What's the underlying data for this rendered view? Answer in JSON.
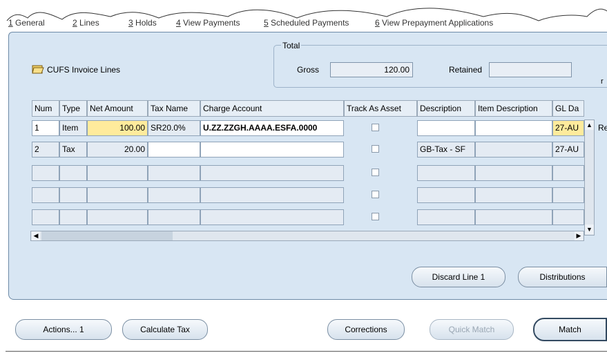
{
  "tabs": [
    {
      "mnemonic": "1",
      "label": " General"
    },
    {
      "mnemonic": "2",
      "label": " Lines"
    },
    {
      "mnemonic": "3",
      "label": " Holds"
    },
    {
      "mnemonic": "4",
      "label": " View Payments"
    },
    {
      "mnemonic": "5",
      "label": " Scheduled Payments"
    },
    {
      "mnemonic": "6",
      "label": " View Prepayment Applications"
    }
  ],
  "section": {
    "title": "CUFS Invoice Lines"
  },
  "total": {
    "legend": "Total",
    "gross_label": "Gross",
    "gross_value": "120.00",
    "retained_label": "Retained",
    "retained_value": ""
  },
  "table": {
    "headers": [
      "Num",
      "Type",
      "Net Amount",
      "Tax Name",
      "Charge Account",
      "Track As Asset",
      "Description",
      "Item Description",
      "GL Da"
    ],
    "rows": [
      {
        "num": "1",
        "type": "Item",
        "net": "100.00",
        "tax": "SR20.0%",
        "account": "U.ZZ.ZZGH.AAAA.ESFA.0000",
        "desc": "",
        "item_desc": "",
        "gl": "27-AU"
      },
      {
        "num": "2",
        "type": "Tax",
        "net": "20.00",
        "tax": "",
        "account": "",
        "desc": "GB-Tax - SF",
        "item_desc": "",
        "gl": "27-AU"
      },
      {
        "num": "",
        "type": "",
        "net": "",
        "tax": "",
        "account": "",
        "desc": "",
        "item_desc": "",
        "gl": ""
      },
      {
        "num": "",
        "type": "",
        "net": "",
        "tax": "",
        "account": "",
        "desc": "",
        "item_desc": "",
        "gl": ""
      },
      {
        "num": "",
        "type": "",
        "net": "",
        "tax": "",
        "account": "",
        "desc": "",
        "item_desc": "",
        "gl": ""
      }
    ]
  },
  "buttons": {
    "discard": "Discard Line 1",
    "distributions": "Distributions",
    "actions": "Actions... 1",
    "calculate_tax": "Calculate Tax",
    "corrections": "Corrections",
    "quick_match": "Quick Match",
    "match": "Match"
  },
  "side_fragments": {
    "r": "r",
    "re": "Re"
  },
  "colors": {
    "panel": "#d8e6f3",
    "required": "#ffeb9c",
    "border": "#6d8aa6"
  }
}
